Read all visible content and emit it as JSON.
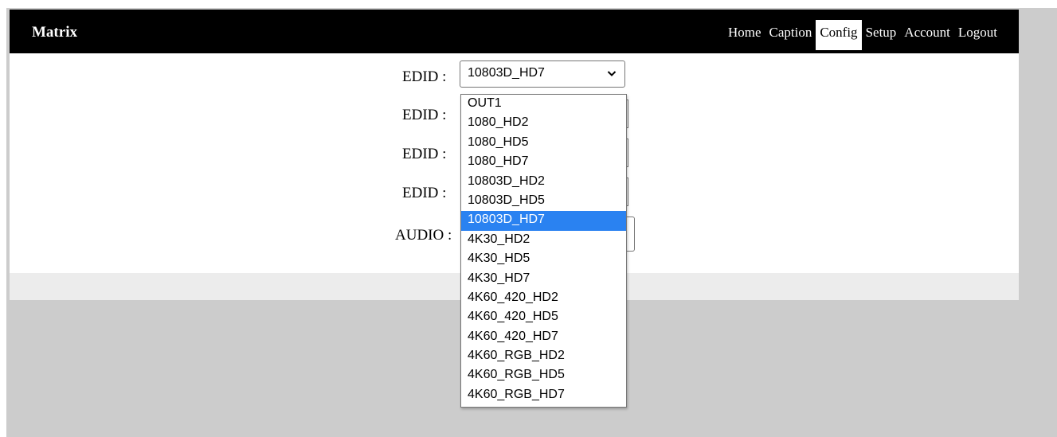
{
  "app": {
    "brand": "Matrix"
  },
  "nav": {
    "items": [
      {
        "label": "Home"
      },
      {
        "label": "Caption"
      },
      {
        "label": "Config",
        "active": true
      },
      {
        "label": "Setup"
      },
      {
        "label": "Account"
      },
      {
        "label": "Logout"
      }
    ]
  },
  "form": {
    "rows": [
      {
        "label": "EDID :"
      },
      {
        "label": "EDID :"
      },
      {
        "label": "EDID :"
      },
      {
        "label": "EDID :"
      },
      {
        "label": "AUDIO :"
      }
    ],
    "edid_select": {
      "value": "10803D_HD7"
    }
  },
  "dropdown": {
    "selected": "10803D_HD7",
    "options": [
      "OUT1",
      "1080_HD2",
      "1080_HD5",
      "1080_HD7",
      "10803D_HD2",
      "10803D_HD5",
      "10803D_HD7",
      "4K30_HD2",
      "4K30_HD5",
      "4K30_HD7",
      "4K60_420_HD2",
      "4K60_420_HD5",
      "4K60_420_HD7",
      "4K60_RGB_HD2",
      "4K60_RGB_HD5",
      "4K60_RGB_HD7"
    ]
  },
  "colors": {
    "navbar": "#000000",
    "selected_option": "#2a82f1",
    "page_bg": "#cccccc"
  }
}
